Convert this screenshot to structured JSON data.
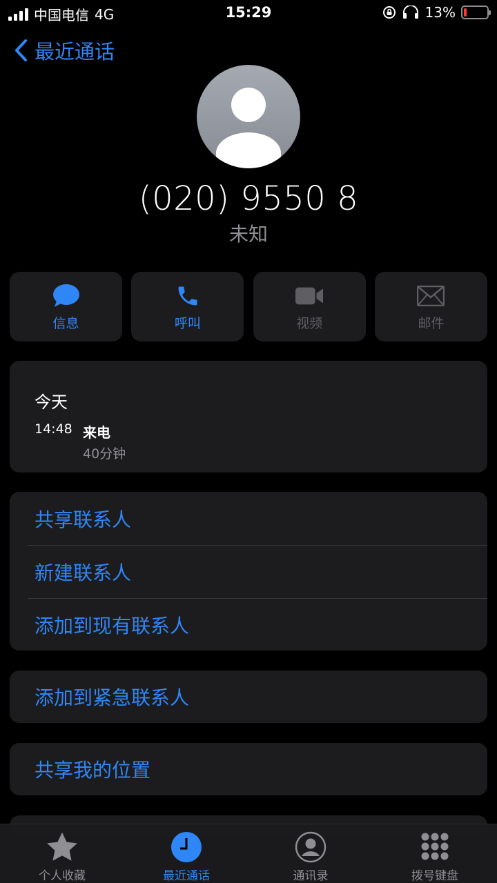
{
  "status_bar": {
    "carrier": "中国电信",
    "network": "4G",
    "time": "15:29",
    "battery": "13%",
    "battery_level": 0.13
  },
  "nav": {
    "back_label": "最近通话"
  },
  "contact": {
    "number": "(020) 9550 8",
    "label": "未知"
  },
  "actions": [
    {
      "label": "信息",
      "icon": "message-icon",
      "enabled": true
    },
    {
      "label": "呼叫",
      "icon": "phone-icon",
      "enabled": true
    },
    {
      "label": "视频",
      "icon": "video-icon",
      "enabled": false
    },
    {
      "label": "邮件",
      "icon": "mail-icon",
      "enabled": false
    }
  ],
  "history": {
    "day": "今天",
    "time": "14:48",
    "type": "来电",
    "duration": "40分钟"
  },
  "contact_options": [
    "共享联系人",
    "新建联系人",
    "添加到现有联系人"
  ],
  "emergency_label": "添加到紧急联系人",
  "share_location_label": "共享我的位置",
  "tabs": [
    {
      "label": "个人收藏",
      "icon": "star-icon"
    },
    {
      "label": "最近通话",
      "icon": "clock-icon",
      "selected": true
    },
    {
      "label": "通讯录",
      "icon": "contacts-icon"
    },
    {
      "label": "拨号键盘",
      "icon": "keypad-icon"
    }
  ],
  "colors": {
    "accent": "#2f86f6",
    "card": "#1c1c1e",
    "secondary_text": "#8e8e93",
    "disabled": "#5e5e63",
    "battery_low": "#ff3b30"
  }
}
